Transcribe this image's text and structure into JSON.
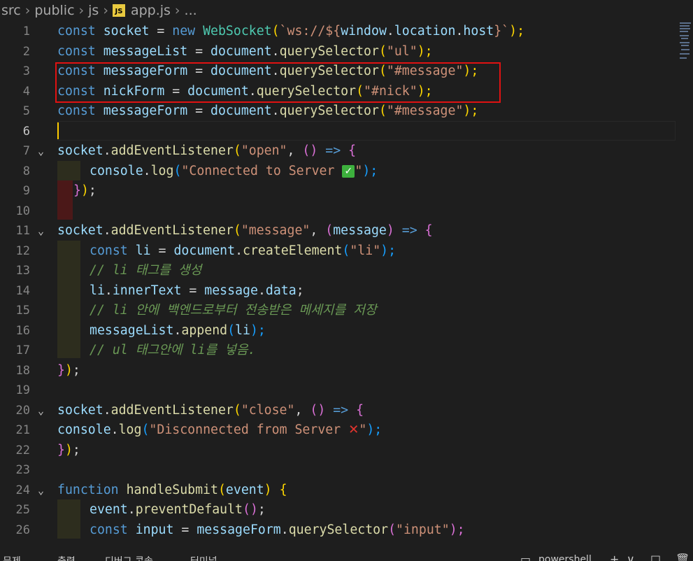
{
  "breadcrumb": {
    "src": "src",
    "public": "public",
    "js": "js",
    "badge": "JS",
    "file": "app.js",
    "more": "..."
  },
  "line_numbers": [
    "1",
    "2",
    "3",
    "4",
    "5",
    "6",
    "7",
    "8",
    "9",
    "10",
    "11",
    "12",
    "13",
    "14",
    "15",
    "16",
    "17",
    "18",
    "19",
    "20",
    "21",
    "22",
    "23",
    "24",
    "25",
    "26"
  ],
  "code": {
    "l1": [
      "const",
      " ",
      "socket",
      " = ",
      "new",
      " ",
      "WebSocket",
      "(",
      "`ws://${",
      "window",
      ".",
      "location",
      ".",
      "host",
      "}`",
      ");"
    ],
    "l2": [
      "const",
      " ",
      "messageList",
      " = ",
      "document",
      ".",
      "querySelector",
      "(",
      "\"ul\"",
      ");"
    ],
    "l3": [
      "const",
      " ",
      "messageForm",
      " = ",
      "document",
      ".",
      "querySelector",
      "(",
      "\"#message\"",
      ");"
    ],
    "l4": [
      "const",
      " ",
      "nickForm",
      " = ",
      "document",
      ".",
      "querySelector",
      "(",
      "\"#nick\"",
      ");"
    ],
    "l5": [
      "const",
      " ",
      "messageForm",
      " = ",
      "document",
      ".",
      "querySelector",
      "(",
      "\"#message\"",
      ");"
    ],
    "l7": [
      "socket",
      ".",
      "addEventListener",
      "(",
      "\"open\"",
      ", ",
      "()",
      " => ",
      "{"
    ],
    "l8": [
      "console",
      ".",
      "log",
      "(",
      "\"Connected to Server ",
      "✓",
      "\"",
      ");"
    ],
    "l9": [
      "}",
      ")",
      ";"
    ],
    "l11": [
      "socket",
      ".",
      "addEventListener",
      "(",
      "\"message\"",
      ", ",
      "(",
      "message",
      ")",
      " => ",
      "{"
    ],
    "l12": [
      "const",
      " ",
      "li",
      " = ",
      "document",
      ".",
      "createElement",
      "(",
      "\"li\"",
      ");"
    ],
    "l13": "// li 태그를 생성",
    "l14": [
      "li",
      ".",
      "innerText",
      " = ",
      "message",
      ".",
      "data",
      ";"
    ],
    "l15": "// li 안에 백엔드로부터 전송받은 메세지를 저장",
    "l16": [
      "messageList",
      ".",
      "append",
      "(",
      "li",
      ");"
    ],
    "l17": "// ul 태그안에 li를 넣음.",
    "l18": [
      "}",
      ")",
      ";"
    ],
    "l20": [
      "socket",
      ".",
      "addEventListener",
      "(",
      "\"close\"",
      ", ",
      "()",
      " => ",
      "{"
    ],
    "l21": [
      "console",
      ".",
      "log",
      "(",
      "\"Disconnected from Server ",
      "✕",
      "\"",
      ");"
    ],
    "l22": [
      "}",
      ")",
      ";"
    ],
    "l24": [
      "function",
      " ",
      "handleSubmit",
      "(",
      "event",
      ") ",
      "{"
    ],
    "l25": [
      "event",
      ".",
      "preventDefault",
      "()",
      ";"
    ],
    "l26": [
      "const",
      " ",
      "input",
      " = ",
      "messageForm",
      ".",
      "querySelector",
      "(",
      "\"input\"",
      ");"
    ]
  },
  "panel": {
    "tab1": "문제",
    "tab2": "출력",
    "tab3": "디버그 콘솔",
    "tab4": "터미널",
    "terminal": "powershell",
    "plus": "+",
    "chevron": "∨",
    "split": "□",
    "trash": "🗑"
  },
  "colors": {
    "background": "#1e1e1e",
    "keyword": "#569cd6",
    "variable": "#9cdcfe",
    "function": "#dcdcaa",
    "string": "#ce9178",
    "comment": "#6a9955",
    "highlight_border": "#e01212",
    "cursor": "#ffcc00"
  },
  "icons": {
    "fold": "chevron-down-icon",
    "check": "check-mark-icon",
    "cross": "cross-mark-icon",
    "js_file": "javascript-file-icon"
  }
}
